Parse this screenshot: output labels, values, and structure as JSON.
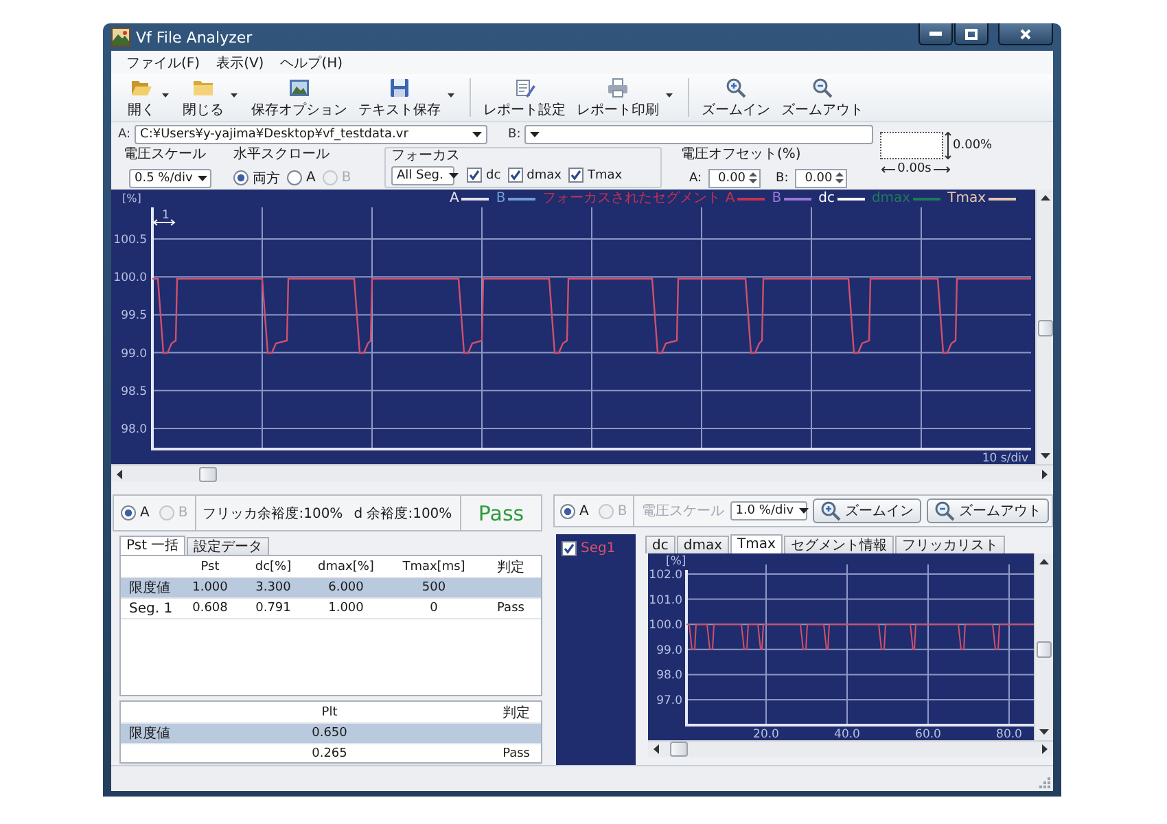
{
  "window": {
    "title": "Vf File Analyzer"
  },
  "menu": [
    "ファイル(F)",
    "表示(V)",
    "ヘルプ(H)"
  ],
  "toolbar": [
    {
      "items": [
        {
          "kind": "open",
          "label": "開く",
          "dropdown": true
        },
        {
          "kind": "close",
          "label": "閉じる",
          "dropdown": true
        },
        {
          "kind": "save-options",
          "label": "保存オプション",
          "dropdown": false
        },
        {
          "kind": "save",
          "label": "テキスト保存",
          "dropdown": true
        }
      ]
    },
    {
      "items": [
        {
          "kind": "report-settings",
          "label": "レポート設定",
          "dropdown": false
        },
        {
          "kind": "print",
          "label": "レポート印刷",
          "dropdown": true
        }
      ]
    },
    {
      "items": [
        {
          "kind": "zoom-in",
          "label": "ズームイン",
          "dropdown": false
        },
        {
          "kind": "zoom-out",
          "label": "ズームアウト",
          "dropdown": false
        }
      ]
    }
  ],
  "files": {
    "a": {
      "label": "A:",
      "value": "C:¥Users¥y-yajima¥Desktop¥vf_testdata.vr"
    },
    "b": {
      "label": "B:"
    }
  },
  "offset_preview": {
    "vertical": "0.00%",
    "horizontal": "0.00s"
  },
  "controls": {
    "voltage_scale": {
      "label": "電圧スケール",
      "value": "0.5 %/div"
    },
    "h_scroll": {
      "label": "水平スクロール",
      "options": [
        {
          "label": "両方",
          "selected": true,
          "disabled": false
        },
        {
          "label": "A",
          "selected": false,
          "disabled": false
        },
        {
          "label": "B",
          "selected": false,
          "disabled": true
        }
      ]
    },
    "focus": {
      "label": "フォーカス",
      "value": "All Seg.",
      "checks": [
        {
          "label": "dc",
          "checked": true
        },
        {
          "label": "dmax",
          "checked": true
        },
        {
          "label": "Tmax",
          "checked": true
        }
      ]
    },
    "voltage_offset": {
      "label": "電圧オフセット(%)",
      "fields": [
        {
          "label": "A:",
          "value": "0.00"
        },
        {
          "label": "B:",
          "value": "0.00"
        }
      ]
    }
  },
  "main_chart": {
    "unit": "[%]",
    "legend": [
      {
        "label": "A",
        "color": "#e4e4ec"
      },
      {
        "label": "B",
        "color": "#6e9fd6"
      },
      {
        "label": "フォーカスされたセグメント A",
        "color": "#c8324e"
      },
      {
        "label": "B",
        "color": "#9c78d8"
      },
      {
        "label": "dc",
        "color": "#ffffff"
      },
      {
        "label": "dmax",
        "color": "#1d7a5c"
      },
      {
        "label": "Tmax",
        "color": "#e8c8b0"
      }
    ],
    "y_labels": [
      "100.5",
      "100.0",
      "99.5",
      "99.0",
      "98.5",
      "98.0"
    ],
    "marker": "1",
    "scale": "10 s/div"
  },
  "summary": {
    "radios": [
      {
        "label": "A",
        "selected": true,
        "disabled": false
      },
      {
        "label": "B",
        "selected": false,
        "disabled": true
      }
    ],
    "flicker_margin": "フリッカ余裕度:100%",
    "d_margin": "d 余裕度:100%",
    "result": "Pass"
  },
  "summary_tabs": [
    {
      "label": "Pst 一括",
      "selected": true
    },
    {
      "label": "設定データ",
      "selected": false
    }
  ],
  "pst_table": {
    "columns": [
      "",
      "Pst",
      "dc[%]",
      "dmax[%]",
      "Tmax[ms]",
      "判定"
    ],
    "rows": [
      {
        "kind": "limit",
        "cells": [
          "限度値",
          "1.000",
          "3.300",
          "6.000",
          "500",
          ""
        ]
      },
      {
        "kind": "value",
        "cells": [
          "Seg. 1",
          "0.608",
          "0.791",
          "1.000",
          "0",
          "Pass"
        ]
      }
    ]
  },
  "plt_table": {
    "columns": [
      "",
      "Plt",
      "判定"
    ],
    "rows": [
      {
        "kind": "limit",
        "cells": [
          "限度値",
          "0.650",
          ""
        ]
      },
      {
        "kind": "value",
        "cells": [
          "",
          "0.265",
          "Pass"
        ]
      }
    ]
  },
  "detail": {
    "radios": [
      {
        "label": "A",
        "selected": true,
        "disabled": false
      },
      {
        "label": "B",
        "selected": false,
        "disabled": true
      }
    ],
    "voltage_scale": {
      "label": "電圧スケール",
      "disabled": true,
      "value": "1.0 %/div"
    },
    "buttons": [
      {
        "kind": "zoom-in",
        "label": "ズームイン"
      },
      {
        "kind": "zoom-out",
        "label": "ズームアウト"
      }
    ],
    "segments": [
      {
        "label": "Seg1",
        "checked": true
      }
    ],
    "tabs": [
      {
        "label": "dc",
        "selected": false
      },
      {
        "label": "dmax",
        "selected": false
      },
      {
        "label": "Tmax",
        "selected": true
      },
      {
        "label": "セグメント情報",
        "selected": false
      },
      {
        "label": "フリッカリスト",
        "selected": false
      }
    ],
    "chart": {
      "unit": "[%]",
      "y_labels": [
        "102.0",
        "101.0",
        "100.0",
        "99.0",
        "98.0",
        "97.0"
      ],
      "x_labels": [
        "20.0",
        "40.0",
        "60.0",
        "80.0"
      ]
    }
  }
}
